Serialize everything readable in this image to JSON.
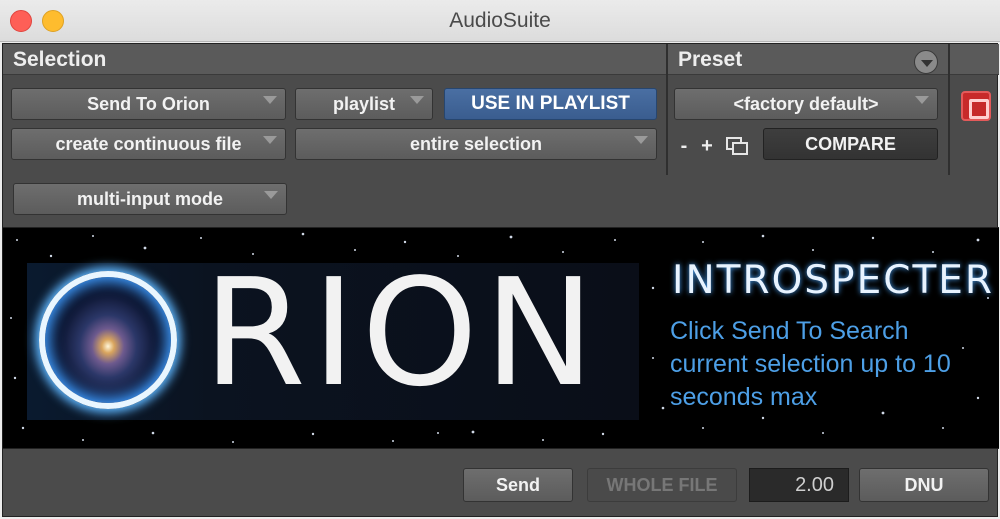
{
  "window": {
    "title": "AudioSuite"
  },
  "selection": {
    "header": "Selection",
    "plugin_label": "Send To Orion",
    "playlist_label": "playlist",
    "use_in_playlist_label": "USE IN PLAYLIST",
    "file_mode_label": "create continuous file",
    "selection_mode_label": "entire selection",
    "input_mode_label": "multi-input mode"
  },
  "preset": {
    "header": "Preset",
    "preset_name": "<factory default>",
    "minus_label": "-",
    "plus_label": "+",
    "compare_label": "COMPARE"
  },
  "banner": {
    "logo_text": "RION",
    "title": "INTROSPECTER",
    "description": "Click Send To Search current selection up to 10 seconds max"
  },
  "footer": {
    "send_label": "Send",
    "whole_file_label": "WHOLE FILE",
    "value": "2.00",
    "dnu_label": "DNU"
  },
  "colors": {
    "accent_blue": "#3a5d8f",
    "record_red": "#c72a2a",
    "description_blue": "#4d9fe6"
  }
}
